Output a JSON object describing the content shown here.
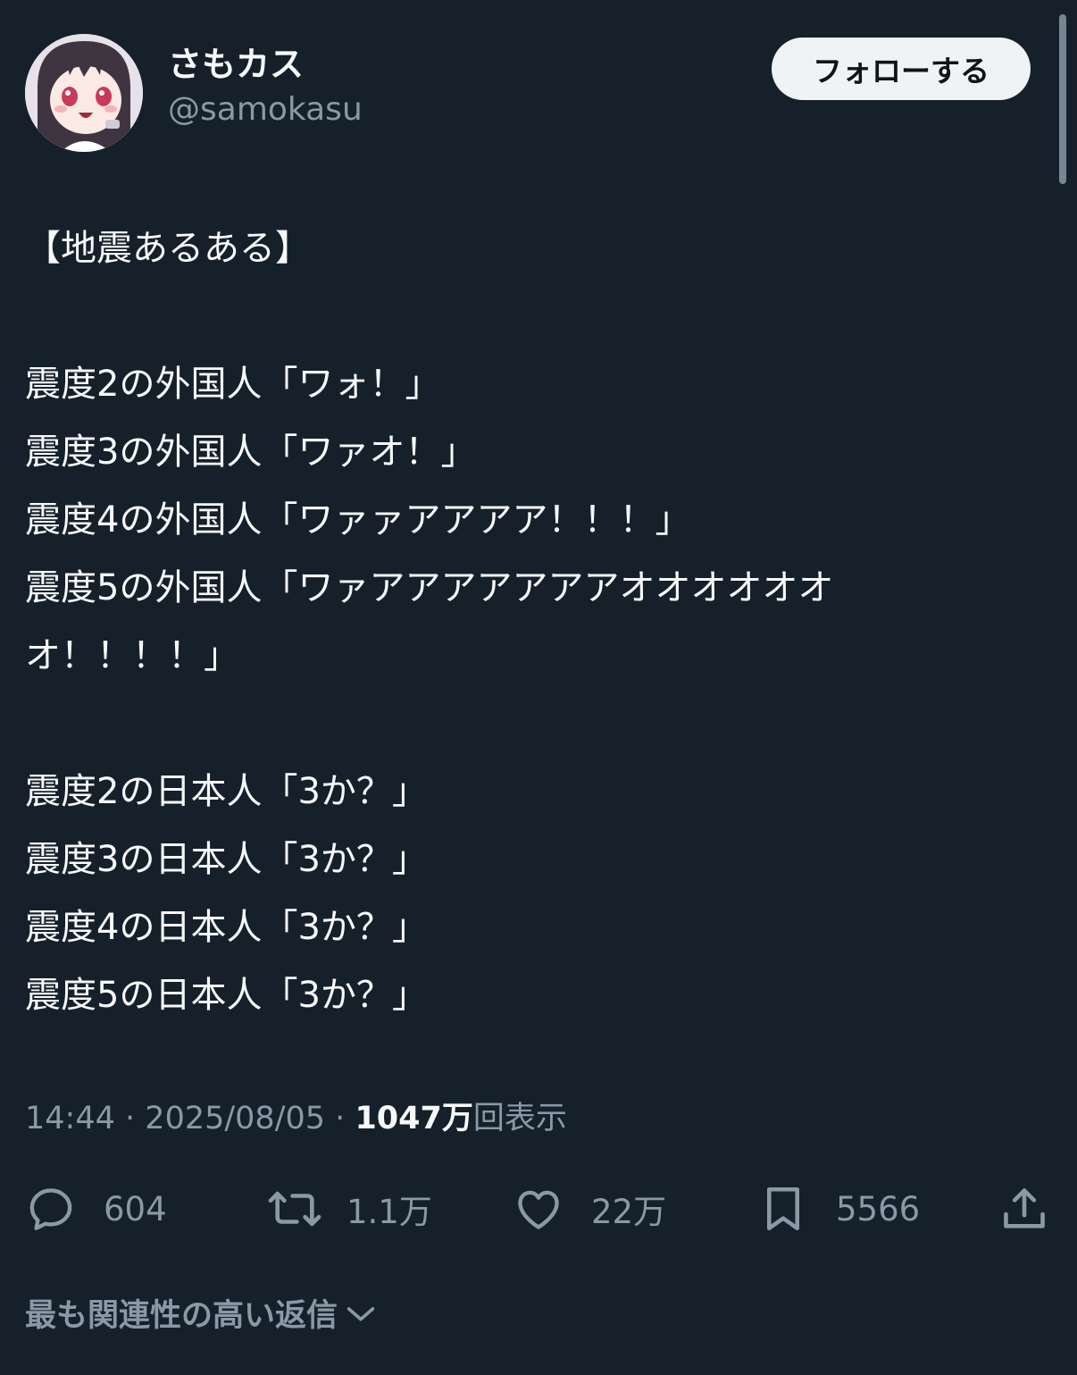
{
  "user": {
    "display_name": "さもカス",
    "handle": "@samokasu"
  },
  "follow_button": "フォローする",
  "tweet_lines": [
    "【地震あるある】",
    "",
    "震度2の外国人「ワォ！」",
    "震度3の外国人「ワァオ！」",
    "震度4の外国人「ワァァアアアア！！！」",
    "震度5の外国人「ワァアアアアアアアオオオオオオ",
    "オ！！！！」",
    "",
    "震度2の日本人「3か？」",
    "震度3の日本人「3か？」",
    "震度4の日本人「3か？」",
    "震度5の日本人「3か？」"
  ],
  "meta": {
    "time": "14:44",
    "separator": "·",
    "date": "2025/08/05",
    "views_count": "1047万",
    "views_label": "回表示"
  },
  "actions": {
    "replies": "604",
    "reposts": "1.1万",
    "likes": "22万",
    "bookmarks": "5566"
  },
  "icons": {
    "reply": "reply-icon",
    "repost": "repost-icon",
    "like": "heart-icon",
    "bookmark": "bookmark-icon",
    "share": "share-icon",
    "sort": "chevron-down-icon"
  },
  "replies_sort_label": "最も関連性の高い返信",
  "colors": {
    "background": "#15202b",
    "text": "#f7f9f9",
    "secondary": "#8b98a5",
    "button_bg": "#eff3f4"
  }
}
